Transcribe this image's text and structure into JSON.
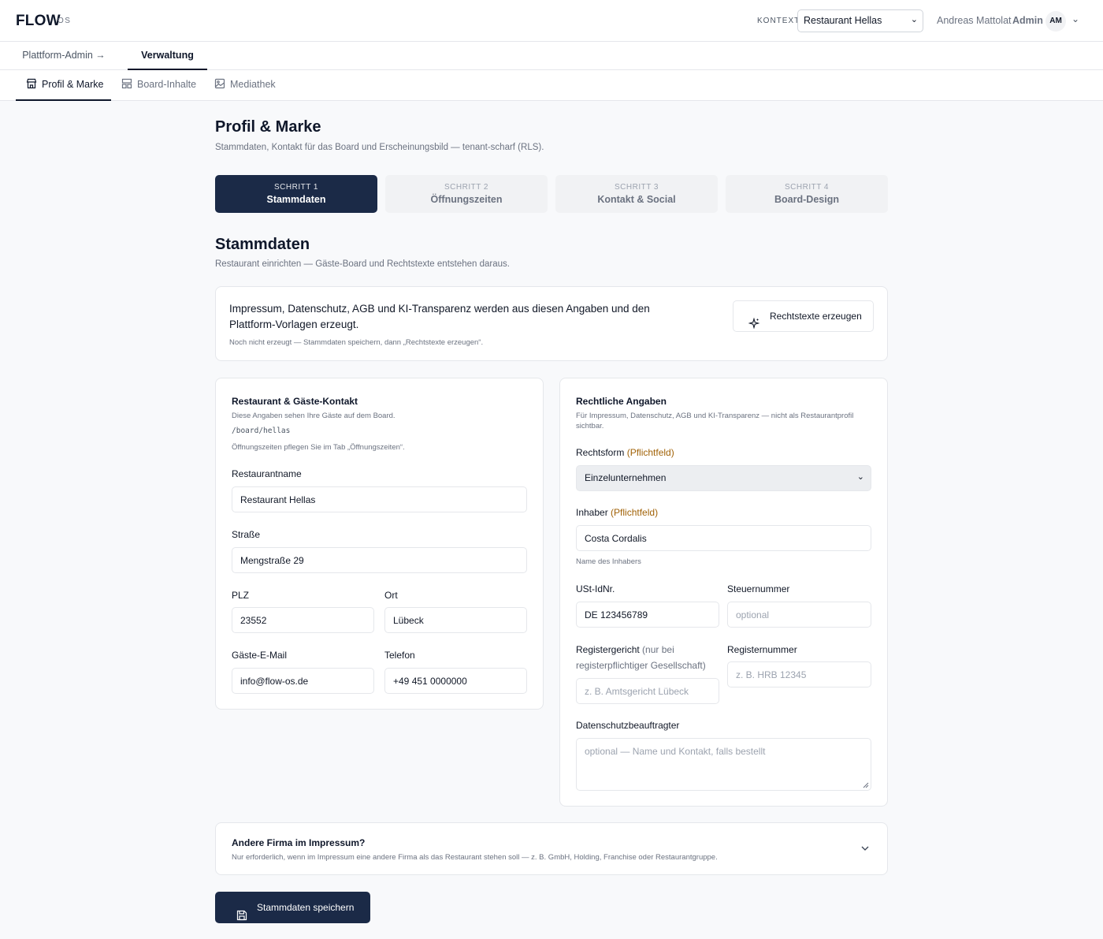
{
  "header": {
    "brand": "FLOW",
    "brand_sub": "OS",
    "context_label": "KONTEXT",
    "context_value": "Restaurant Hellas",
    "user_name": "Andreas Mattolat",
    "user_role": "Admin",
    "avatar": "AM"
  },
  "nav_primary": [
    {
      "label": "Plattform-Admin →",
      "active": false
    },
    {
      "label": "Verwaltung",
      "active": true
    }
  ],
  "nav_secondary": [
    {
      "label": "Profil & Marke",
      "icon": "store-icon",
      "active": true
    },
    {
      "label": "Board-Inhalte",
      "icon": "layout-icon",
      "active": false
    },
    {
      "label": "Mediathek",
      "icon": "image-icon",
      "active": false
    }
  ],
  "page": {
    "title": "Profil & Marke",
    "subtitle": "Stammdaten, Kontakt für das Board und Erscheinungsbild — tenant-scharf (RLS)."
  },
  "steps": [
    {
      "label": "SCHRITT 1",
      "name": "Stammdaten",
      "active": true
    },
    {
      "label": "SCHRITT 2",
      "name": "Öffnungszeiten",
      "active": false
    },
    {
      "label": "SCHRITT 3",
      "name": "Kontakt & Social",
      "active": false
    },
    {
      "label": "SCHRITT 4",
      "name": "Board-Design",
      "active": false
    }
  ],
  "section": {
    "title": "Stammdaten",
    "subtitle": "Restaurant einrichten — Gäste-Board und Rechtstexte entstehen daraus."
  },
  "legal_info": {
    "text": "Impressum, Datenschutz, AGB und KI-Transparenz werden aus diesen Angaben und den Plattform-Vorlagen erzeugt.",
    "note": "Noch nicht erzeugt — Stammdaten speichern, dann „Rechtstexte erzeugen“.",
    "button_label": "Rechtstexte erzeugen"
  },
  "contact_card": {
    "title": "Restaurant & Gäste-Kontakt",
    "desc": "Diese Angaben sehen Ihre Gäste auf dem Board.",
    "board_path": "/board/hellas",
    "hours_note": "Öffnungszeiten pflegen Sie im Tab „Öffnungszeiten“.",
    "fields": {
      "name": {
        "label": "Restaurantname",
        "value": "Restaurant Hellas"
      },
      "street": {
        "label": "Straße",
        "value": "Mengstraße 29"
      },
      "zip": {
        "label": "PLZ",
        "value": "23552"
      },
      "city": {
        "label": "Ort",
        "value": "Lübeck"
      },
      "email": {
        "label": "Gäste-E-Mail",
        "value": "info@flow-os.de"
      },
      "phone": {
        "label": "Telefon",
        "value": "+49 451 0000000"
      }
    }
  },
  "legal_card": {
    "title": "Rechtliche Angaben",
    "desc": "Für Impressum, Datenschutz, AGB und KI-Transparenz — nicht als Restaurantprofil sichtbar.",
    "required_marker": "(Pflichtfeld)",
    "fields": {
      "legal_form": {
        "label": "Rechtsform",
        "value": "Einzelunternehmen"
      },
      "owner": {
        "label": "Inhaber",
        "value": "Costa Cordalis",
        "hint": "Name des Inhabers"
      },
      "vat": {
        "label": "USt-IdNr.",
        "value": "DE 123456789"
      },
      "tax": {
        "label": "Steuernummer",
        "placeholder": "optional"
      },
      "court": {
        "label": "Registergericht",
        "hint": "(nur bei registerpflichtiger Gesellschaft)",
        "placeholder": "z. B. Amtsgericht Lübeck"
      },
      "reg_no": {
        "label": "Registernummer",
        "placeholder": "z. B. HRB 12345"
      },
      "dpo": {
        "label": "Datenschutzbeauftragter",
        "placeholder": "optional — Name und Kontakt, falls bestellt"
      }
    }
  },
  "accordion": {
    "title": "Andere Firma im Impressum?",
    "desc": "Nur erforderlich, wenn im Impressum eine andere Firma als das Restaurant stehen soll — z. B. GmbH, Holding, Franchise oder Restaurantgruppe."
  },
  "save_button": "Stammdaten speichern"
}
